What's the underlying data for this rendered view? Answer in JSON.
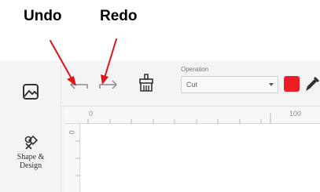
{
  "annotations": {
    "undo": "Undo",
    "redo": "Redo",
    "arrow_color": "#e0131b"
  },
  "toolbar": {
    "operation_label": "Operation",
    "operation_value": "Cut",
    "color_swatch": "#ee1c24",
    "icons": [
      "undo-icon",
      "redo-icon",
      "clear-canvas-icon",
      "color-picker-icon"
    ]
  },
  "left_panel": {
    "items": [
      {
        "icon": "image-icon"
      },
      {
        "icon": "shapes-icon",
        "label_line1": "Shape &",
        "label_line2": "Design"
      }
    ]
  },
  "rulers": {
    "h_start": "0",
    "h_end": "100",
    "v_start": "0"
  }
}
